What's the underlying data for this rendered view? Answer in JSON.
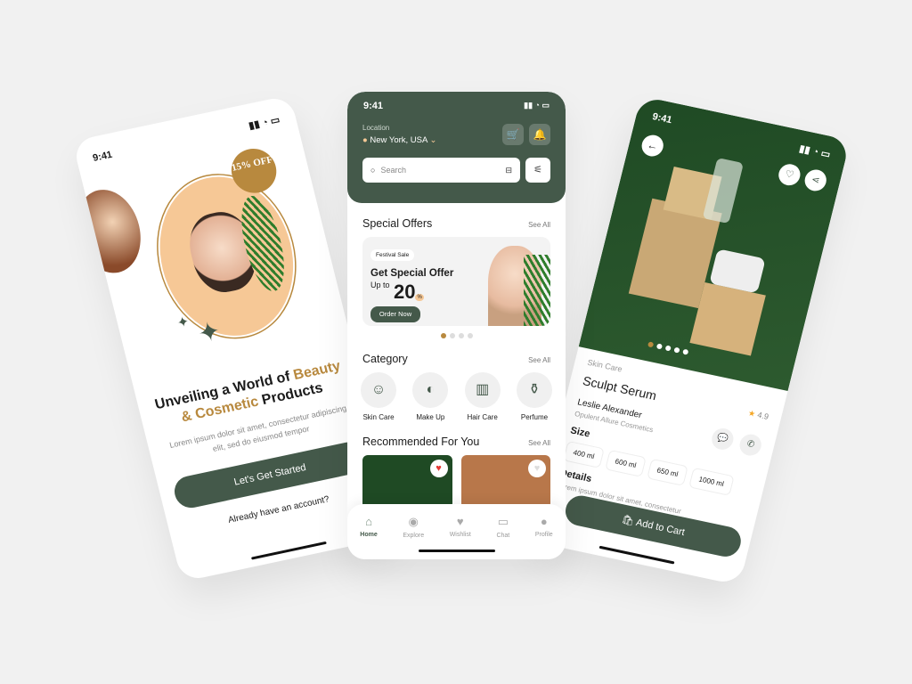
{
  "status_time": "9:41",
  "onboarding": {
    "badge": "15% OFF",
    "title_a": "Unveiling a World of ",
    "title_b": "Beauty",
    "title_c": "& Cosmetic",
    "title_d": " Products",
    "body": "Lorem ipsum dolor sit amet, consectetur adipiscing elit, sed do eiusmod tempor",
    "cta": "Let's Get Started",
    "signin": "Already have an account?"
  },
  "home": {
    "location_label": "Location",
    "location": "New York, USA",
    "search_placeholder": "Search",
    "offers_title": "Special Offers",
    "see_all": "See All",
    "offer": {
      "tag": "Festival Sale",
      "title": "Get Special Offer",
      "upto": "Up to",
      "value": "20",
      "unit": "%",
      "cta": "Order Now"
    },
    "category_title": "Category",
    "categories": [
      {
        "label": "Skin Care",
        "icon": "face-mask-icon"
      },
      {
        "label": "Make Up",
        "icon": "makeup-icon"
      },
      {
        "label": "Hair Care",
        "icon": "hair-care-icon"
      },
      {
        "label": "Perfume",
        "icon": "perfume-icon"
      }
    ],
    "recommended_title": "Recommended For You",
    "nav": [
      {
        "label": "Home",
        "icon": "home-icon"
      },
      {
        "label": "Explore",
        "icon": "explore-icon"
      },
      {
        "label": "Wishlist",
        "icon": "heart-icon"
      },
      {
        "label": "Chat",
        "icon": "chat-icon"
      },
      {
        "label": "Profile",
        "icon": "profile-icon"
      }
    ]
  },
  "product": {
    "category": "Skin Care",
    "name": "Sculpt Serum",
    "rating": "4.9",
    "seller": "Leslie Alexander",
    "brand": "Opulent Allure Cosmetics",
    "size_title": "Size",
    "sizes": [
      "400 ml",
      "600 ml",
      "650 ml",
      "1000 ml"
    ],
    "details_title": "Details",
    "details": "Lorem ipsum dolor sit amet, consectetur",
    "cta": "Add to Cart"
  },
  "colors": {
    "primary": "#44594a",
    "accent": "#b8893e",
    "peach": "#f6c896"
  }
}
